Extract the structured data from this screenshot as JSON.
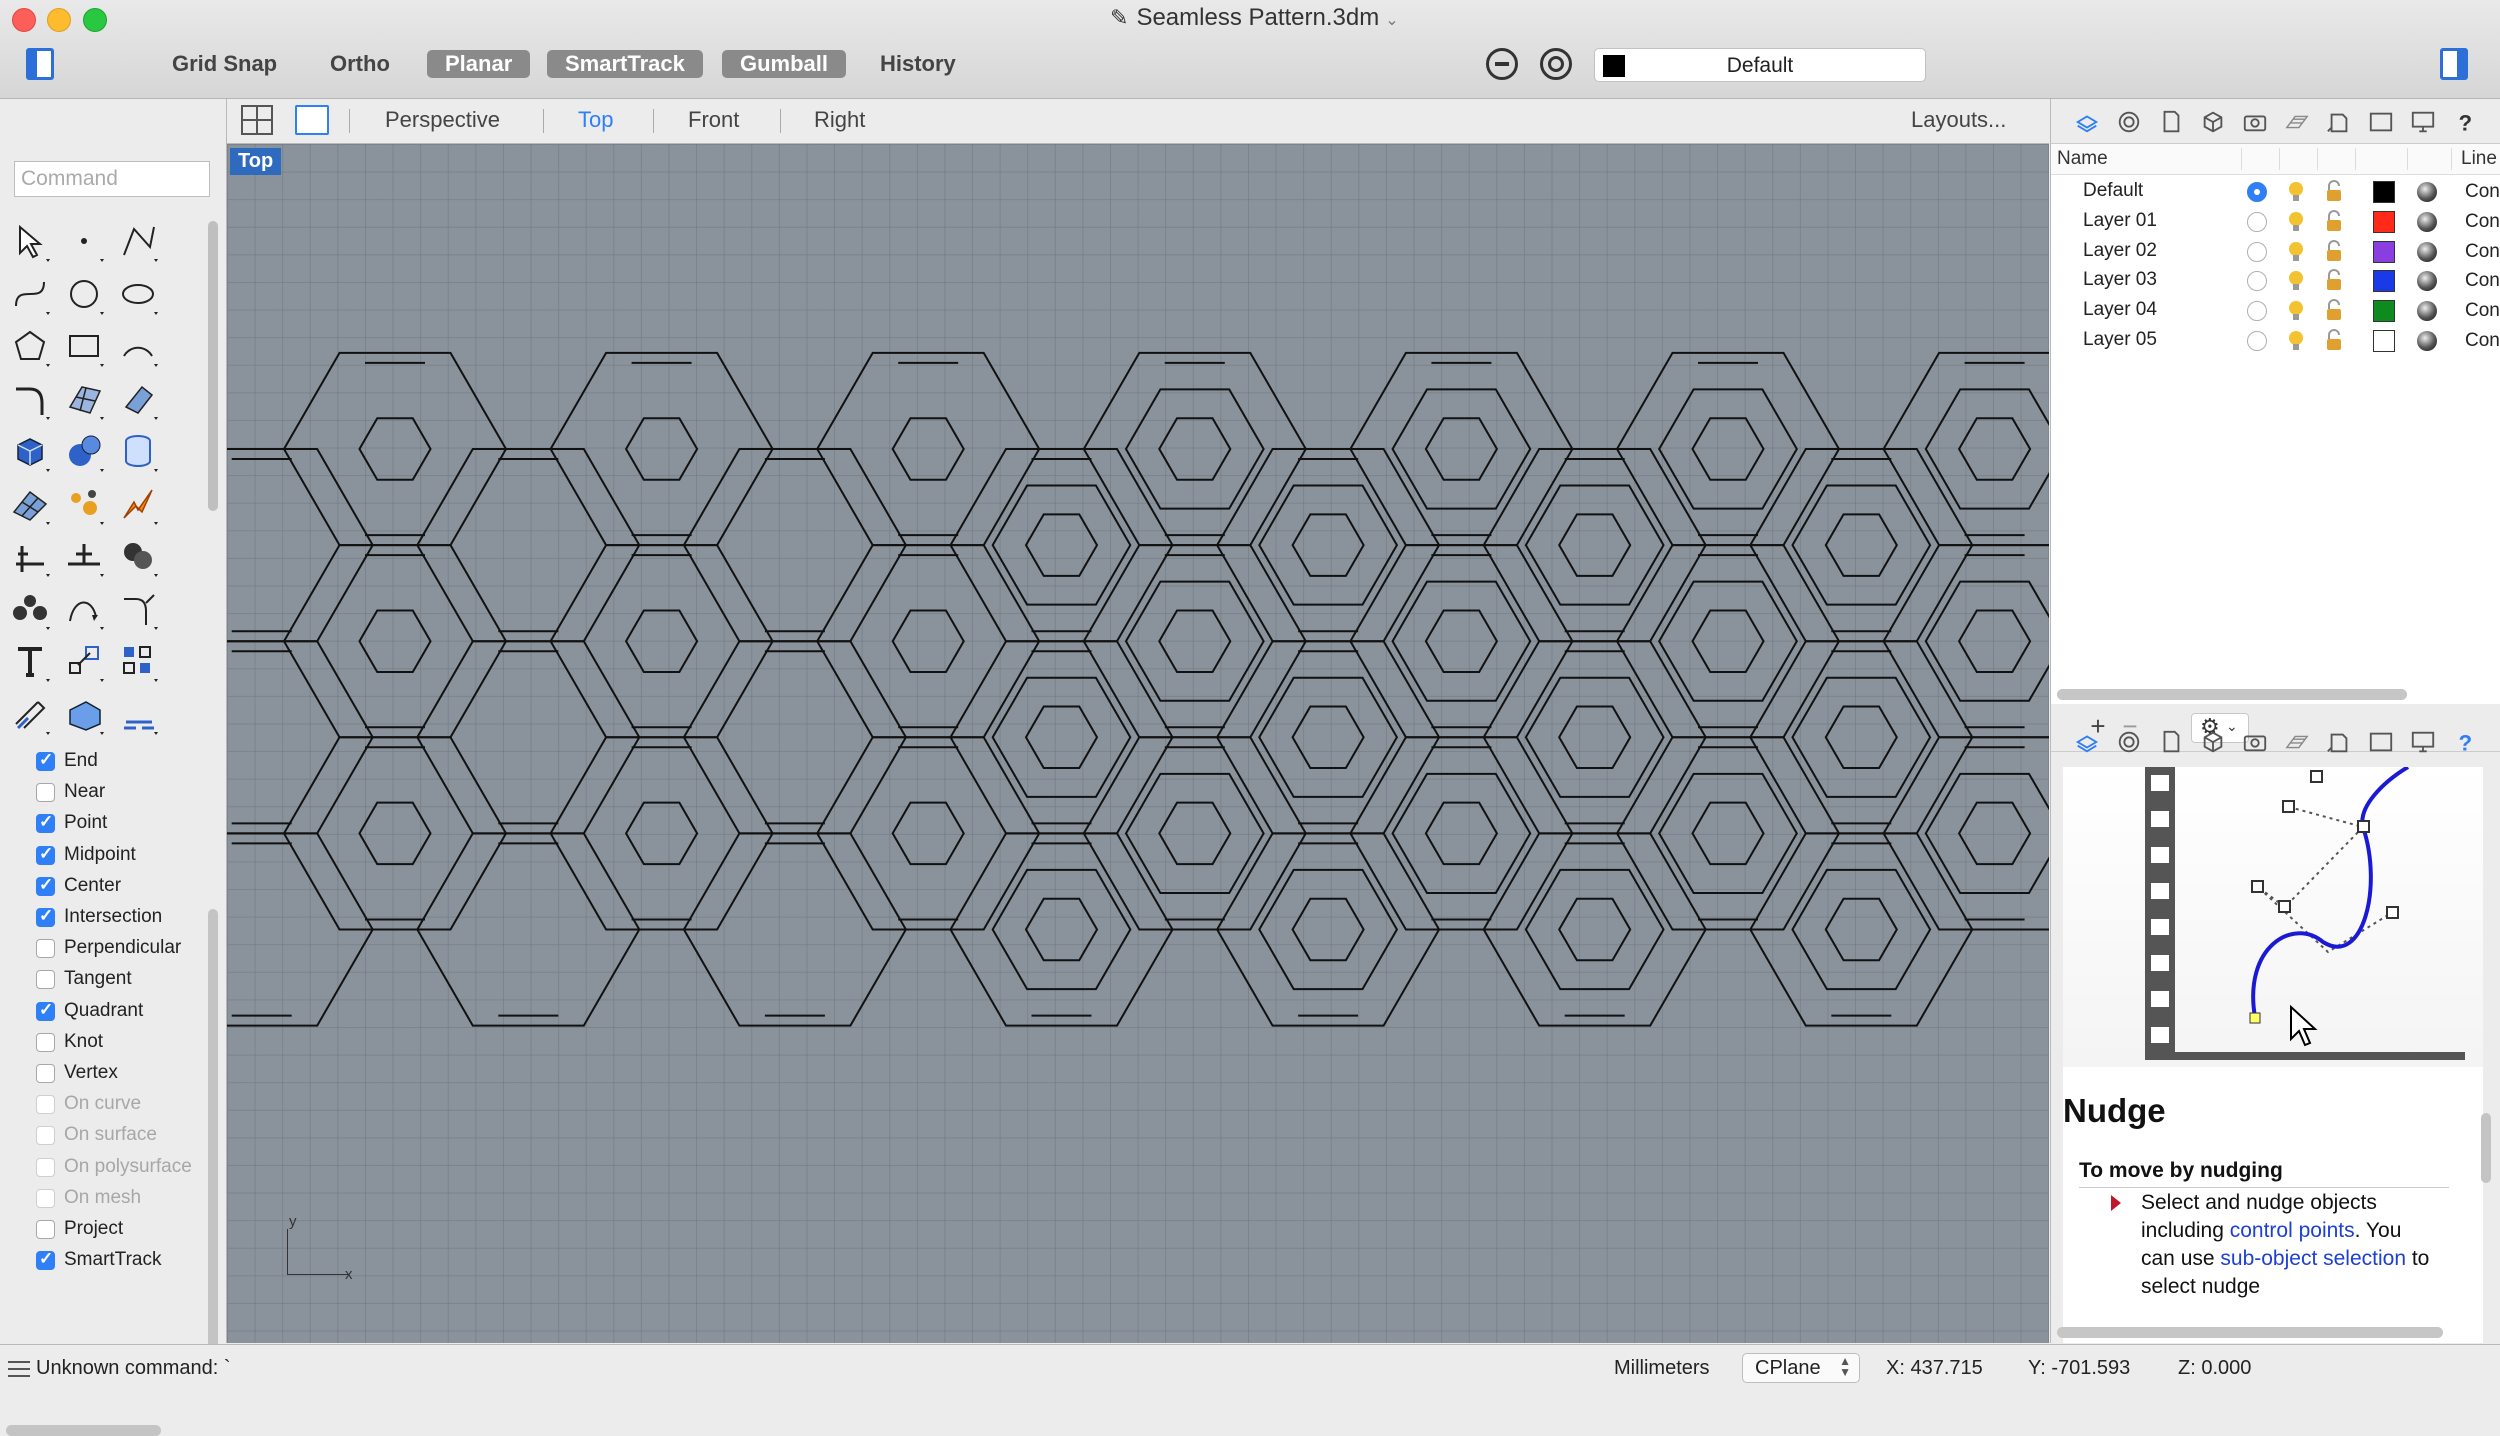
{
  "window": {
    "title": "Seamless Pattern.3dm",
    "modes": [
      {
        "label": "Grid Snap",
        "active": false
      },
      {
        "label": "Ortho",
        "active": false
      },
      {
        "label": "Planar",
        "active": true
      },
      {
        "label": "SmartTrack",
        "active": true
      },
      {
        "label": "Gumball",
        "active": true
      },
      {
        "label": "History",
        "active": false
      }
    ],
    "current_layer": {
      "label": "Default",
      "color": "#000000"
    }
  },
  "command": {
    "placeholder": "Command"
  },
  "viewport": {
    "tabs": [
      "Perspective",
      "Top",
      "Front",
      "Right"
    ],
    "active_tab": "Top",
    "layouts_label": "Layouts...",
    "label": "Top",
    "axis": {
      "x": "x",
      "y": "y"
    }
  },
  "toolbar_icons": [
    "select-arrow-icon",
    "point-icon",
    "polyline-icon",
    "curve-icon",
    "circle-icon",
    "ellipse-icon",
    "polygon-icon",
    "rectangle-icon",
    "arc-icon",
    "fillet-icon",
    "surface-grid-icon",
    "extrude-icon",
    "box-solid-icon",
    "sphere-icon",
    "cylinder-icon",
    "mesh-icon",
    "edit-points-icon",
    "explode-icon",
    "split-icon",
    "trim-icon",
    "boolean-icon",
    "group-icon",
    "rebuild-icon",
    "blend-icon",
    "text-icon",
    "scale-icon",
    "array-icon",
    "dimension-icon",
    "render-icon",
    "hatch-icon"
  ],
  "osnaps": [
    {
      "label": "End",
      "checked": true,
      "enabled": true
    },
    {
      "label": "Near",
      "checked": false,
      "enabled": true
    },
    {
      "label": "Point",
      "checked": true,
      "enabled": true
    },
    {
      "label": "Midpoint",
      "checked": true,
      "enabled": true
    },
    {
      "label": "Center",
      "checked": true,
      "enabled": true
    },
    {
      "label": "Intersection",
      "checked": true,
      "enabled": true
    },
    {
      "label": "Perpendicular",
      "checked": false,
      "enabled": true
    },
    {
      "label": "Tangent",
      "checked": false,
      "enabled": true
    },
    {
      "label": "Quadrant",
      "checked": true,
      "enabled": true
    },
    {
      "label": "Knot",
      "checked": false,
      "enabled": true
    },
    {
      "label": "Vertex",
      "checked": false,
      "enabled": true
    },
    {
      "label": "On curve",
      "checked": false,
      "enabled": false
    },
    {
      "label": "On surface",
      "checked": false,
      "enabled": false
    },
    {
      "label": "On polysurface",
      "checked": false,
      "enabled": false
    },
    {
      "label": "On mesh",
      "checked": false,
      "enabled": false
    },
    {
      "label": "Project",
      "checked": false,
      "enabled": true
    },
    {
      "label": "SmartTrack",
      "checked": true,
      "enabled": true
    }
  ],
  "layers": {
    "header": {
      "name": "Name",
      "linetype": "Line"
    },
    "rows": [
      {
        "name": "Default",
        "current": true,
        "color": "#000000",
        "linetype": "Con"
      },
      {
        "name": "Layer 01",
        "current": false,
        "color": "#ff2a1a",
        "linetype": "Con"
      },
      {
        "name": "Layer 02",
        "current": false,
        "color": "#8a3ee0",
        "linetype": "Con"
      },
      {
        "name": "Layer 03",
        "current": false,
        "color": "#1a3ae8",
        "linetype": "Con"
      },
      {
        "name": "Layer 04",
        "current": false,
        "color": "#0f8a1e",
        "linetype": "Con"
      },
      {
        "name": "Layer 05",
        "current": false,
        "color": "#ffffff",
        "linetype": "Con"
      }
    ],
    "add_label": "+",
    "remove_label": "−",
    "gear_glyph": "⚙",
    "chevron_glyph": "⌄"
  },
  "panel_tab_icons": [
    "layers-tab-icon",
    "materials-tab-icon",
    "document-tab-icon",
    "object-tab-icon",
    "camera-tab-icon",
    "environment-tab-icon",
    "display-tab-icon",
    "viewport-tab-icon",
    "monitor-tab-icon",
    "help-tab-icon"
  ],
  "help": {
    "title": "Nudge",
    "subhead": "To move by nudging",
    "text_1": "Select and nudge objects including ",
    "link_1": "control points",
    "text_2": ". You can use ",
    "link_2": "sub-object selection",
    "text_3": " to select nudge"
  },
  "status": {
    "message": "Unknown command: `",
    "units": "Millimeters",
    "cplane": "CPlane",
    "x": "X: 437.715",
    "y": "Y: -701.593",
    "z": "Z: 0.000"
  }
}
